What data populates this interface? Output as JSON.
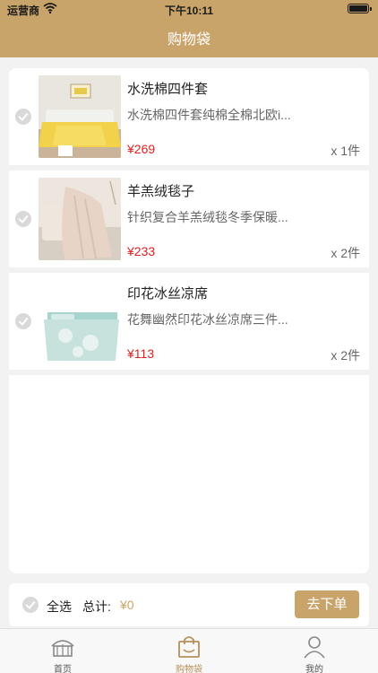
{
  "status_bar": {
    "carrier": "运营商",
    "time": "下午10:11"
  },
  "nav": {
    "title": "购物袋"
  },
  "cart": {
    "items": [
      {
        "title": "水洗棉四件套",
        "desc": "水洗棉四件套纯棉全棉北欧i...",
        "price": "¥269",
        "qty": "x 1件",
        "image": "yellow-bedding-set"
      },
      {
        "title": "羊羔绒毯子",
        "desc": "针织复合羊羔绒毯冬季保暖...",
        "price": "¥233",
        "qty": "x 2件",
        "image": "beige-blanket"
      },
      {
        "title": "印花冰丝凉席",
        "desc": "花舞幽然印花冰丝凉席三件...",
        "price": "¥113",
        "qty": "x 2件",
        "image": "blue-floral-mat"
      }
    ]
  },
  "checkout": {
    "select_all": "全选",
    "total_label": "总计:",
    "total_value": "¥0",
    "button": "去下单"
  },
  "tabs": [
    {
      "label": "首页",
      "icon": "home-icon"
    },
    {
      "label": "购物袋",
      "icon": "bag-icon"
    },
    {
      "label": "我的",
      "icon": "profile-icon"
    }
  ],
  "colors": {
    "accent": "#c9a46a",
    "price": "#e02020",
    "check": "#d9d9d9"
  }
}
